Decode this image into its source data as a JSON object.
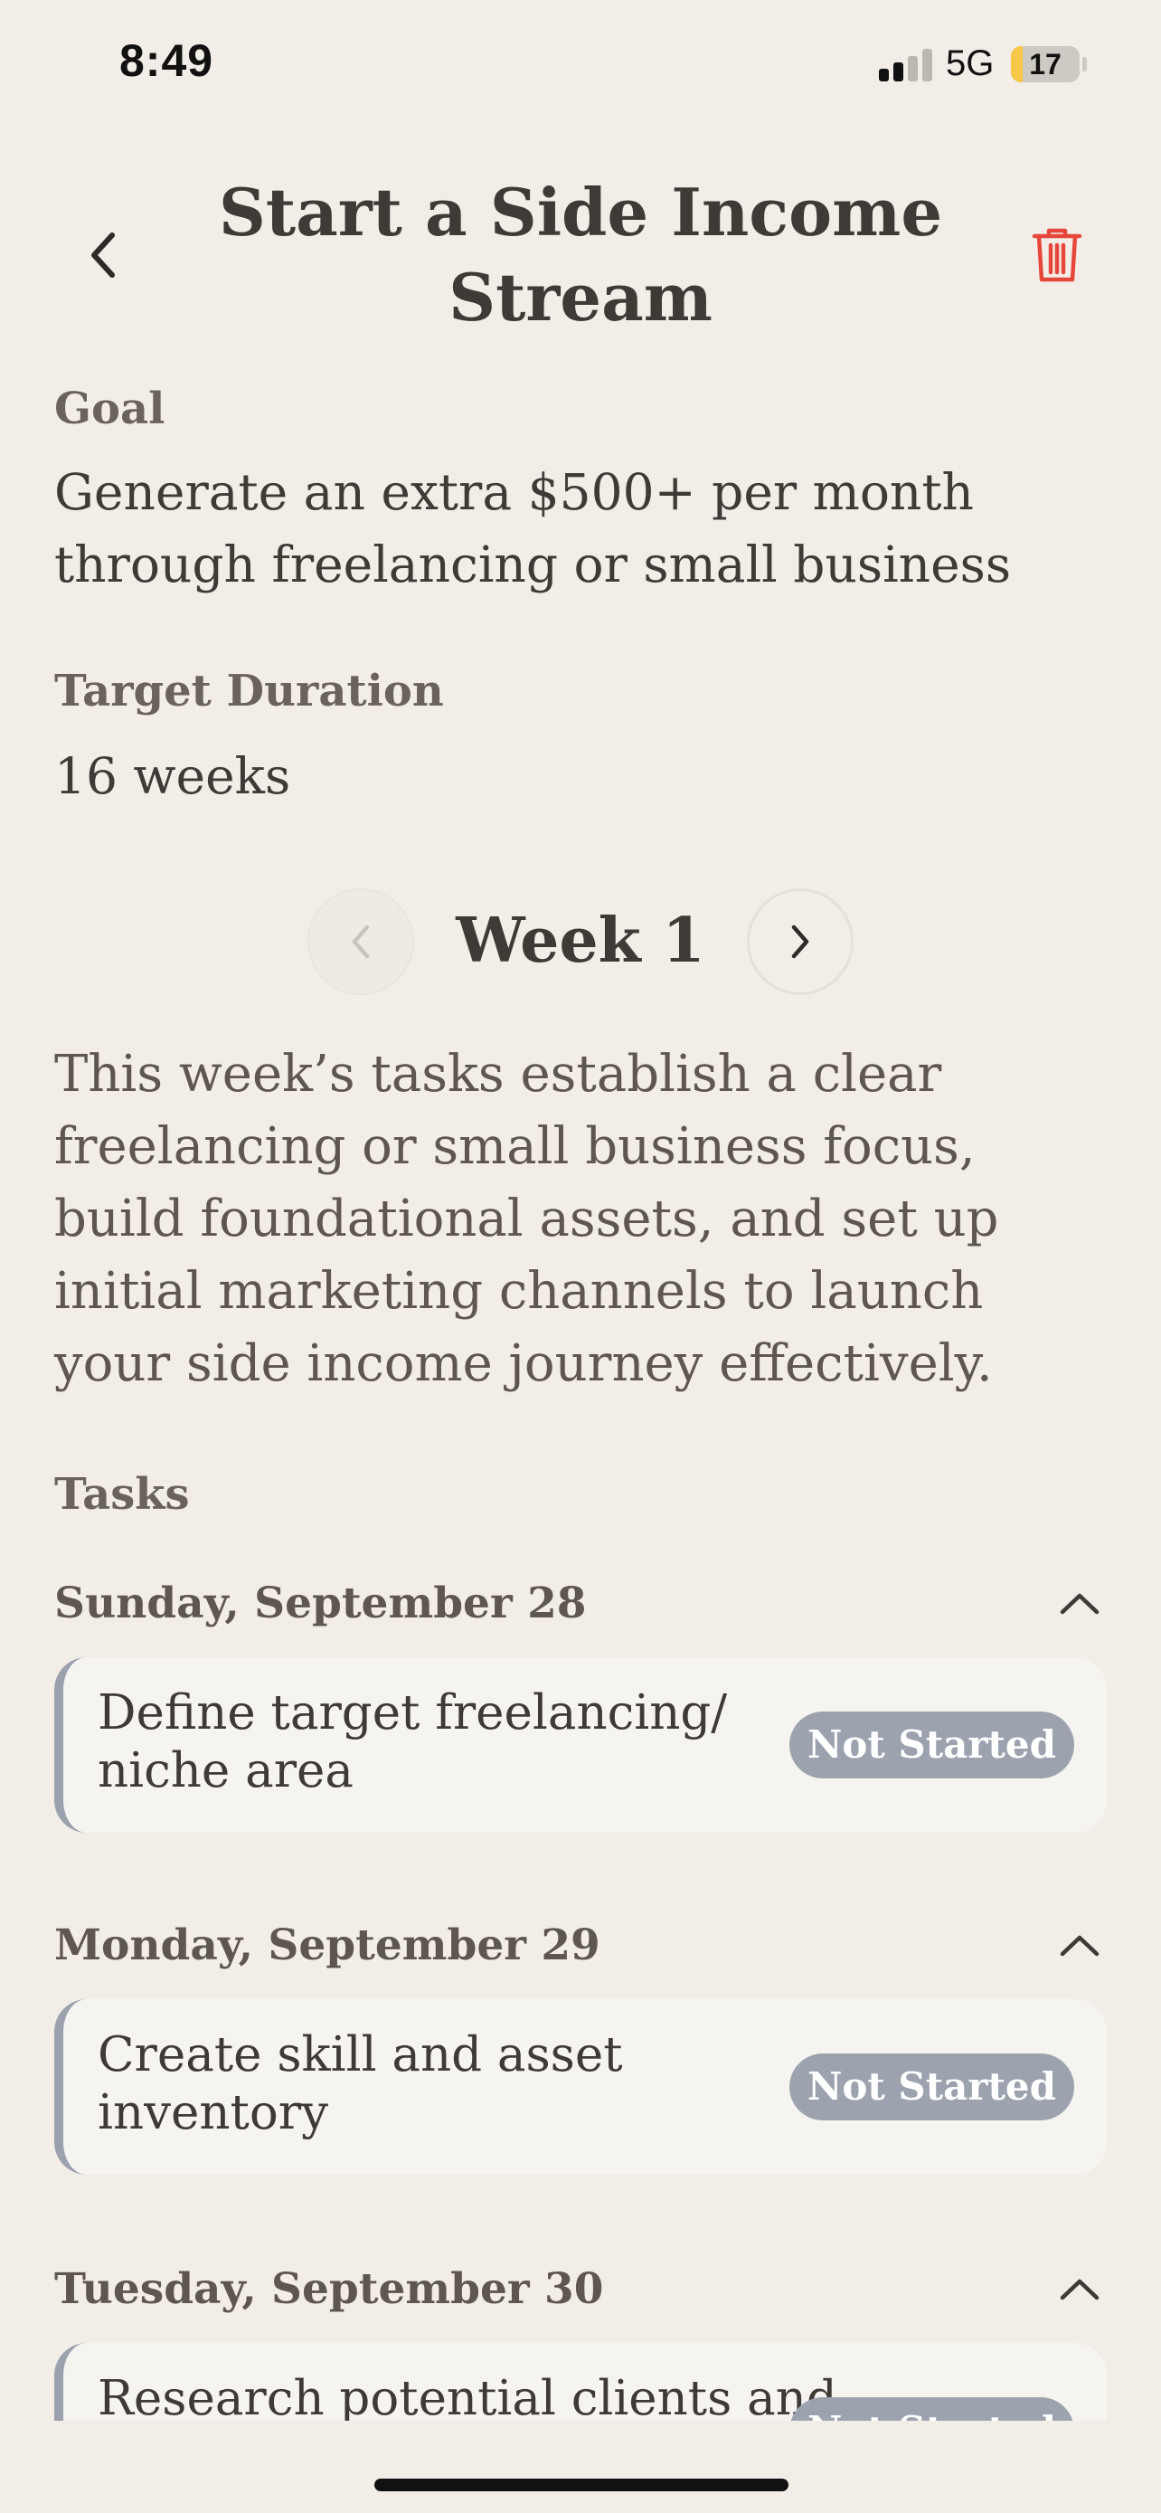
{
  "status_bar": {
    "time": "8:49",
    "network": "5G",
    "battery": "17",
    "battery_level": 0.17,
    "signal_bars": 2,
    "signal_total": 4
  },
  "header": {
    "title": "Start a Side Income Stream",
    "back_icon": "chevron-left-icon",
    "delete_icon": "trash-icon"
  },
  "goal": {
    "label": "Goal",
    "value": "Generate an extra $500+ per month through freelancing or small business"
  },
  "duration": {
    "label": "Target Duration",
    "value": "16 weeks"
  },
  "week_nav": {
    "title": "Week 1",
    "prev_enabled": false,
    "next_enabled": true
  },
  "week_summary": "This week’s tasks establish a clear freelancing or small business focus, build foundational assets, and set up initial marketing channels to launch your side income journey effectively.",
  "tasks": {
    "heading": "Tasks",
    "days": [
      {
        "date": "Sunday, September 28",
        "task": "Define target freelancing/ niche area",
        "status": "Not Started"
      },
      {
        "date": "Monday, September 29",
        "task": "Create skill and asset inventory",
        "status": "Not Started"
      },
      {
        "date": "Tuesday, September 30",
        "task": "Research potential clients and",
        "status": "Not Started"
      }
    ]
  },
  "colors": {
    "background": "#F3EDE8",
    "text": "#3F3A36",
    "delete": "#E5483B",
    "badge": "#9CA3AF",
    "card": "#F6F4F1",
    "battery_fill": "#F6C84A"
  }
}
